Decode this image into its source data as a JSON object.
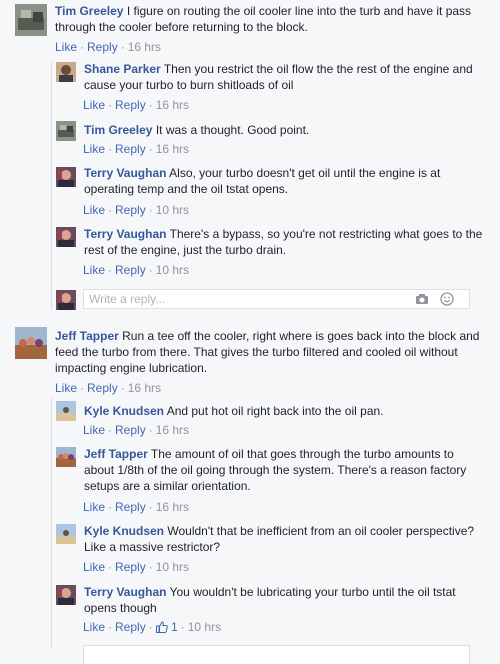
{
  "actions": {
    "like": "Like",
    "reply": "Reply"
  },
  "reply_box": {
    "placeholder": "Write a reply..."
  },
  "comments": [
    {
      "author": "Tim Greeley",
      "text": "I figure on routing the oil cooler line into the turb and have it pass through the cooler before returning to the block.",
      "time": "16 hrs",
      "avatar": "photo-avatar"
    },
    {
      "author": "Shane Parker",
      "text": "Then you restrict the oil flow the the rest of the engine and cause your turbo to burn shitloads of oil",
      "time": "16 hrs",
      "avatar": "photo-avatar"
    },
    {
      "author": "Tim Greeley",
      "text": "It was a thought. Good point.",
      "time": "16 hrs",
      "avatar": "photo-avatar"
    },
    {
      "author": "Terry Vaughan",
      "text": "Also, your turbo doesn't get oil until the engine is at operating temp and the oil tstat opens.",
      "time": "10 hrs",
      "avatar": "photo-avatar"
    },
    {
      "author": "Terry Vaughan",
      "text": "There's a bypass, so you're not restricting what goes to the rest of the engine, just the turbo drain.",
      "time": "10 hrs",
      "avatar": "photo-avatar"
    },
    {
      "author": "Jeff Tapper",
      "text": "Run a tee off the cooler, right where is goes back into the block and feed the turbo from there. That gives the turbo filtered and cooled oil without impacting engine lubrication.",
      "time": "16 hrs",
      "avatar": "photo-avatar"
    },
    {
      "author": "Kyle Knudsen",
      "text": "And put hot oil right back into the oil pan.",
      "time": "16 hrs",
      "avatar": "photo-avatar"
    },
    {
      "author": "Jeff Tapper",
      "text": "The amount of oil that goes through the turbo amounts to about 1/8th of the oil going through the system. There's a reason factory setups are a similar orientation.",
      "time": "16 hrs",
      "avatar": "photo-avatar"
    },
    {
      "author": "Kyle Knudsen",
      "text": "Wouldn't that be inefficient from an oil cooler perspective? Like a massive restrictor?",
      "time": "10 hrs",
      "avatar": "photo-avatar"
    },
    {
      "author": "Terry Vaughan",
      "text": "You wouldn't be lubricating your turbo until the oil tstat opens though",
      "time": "10 hrs",
      "like_count": "1",
      "avatar": "photo-avatar"
    }
  ],
  "colors": {
    "link": "#365899",
    "action": "#4267b2",
    "meta": "#90949c",
    "background": "#f6f7f9"
  }
}
